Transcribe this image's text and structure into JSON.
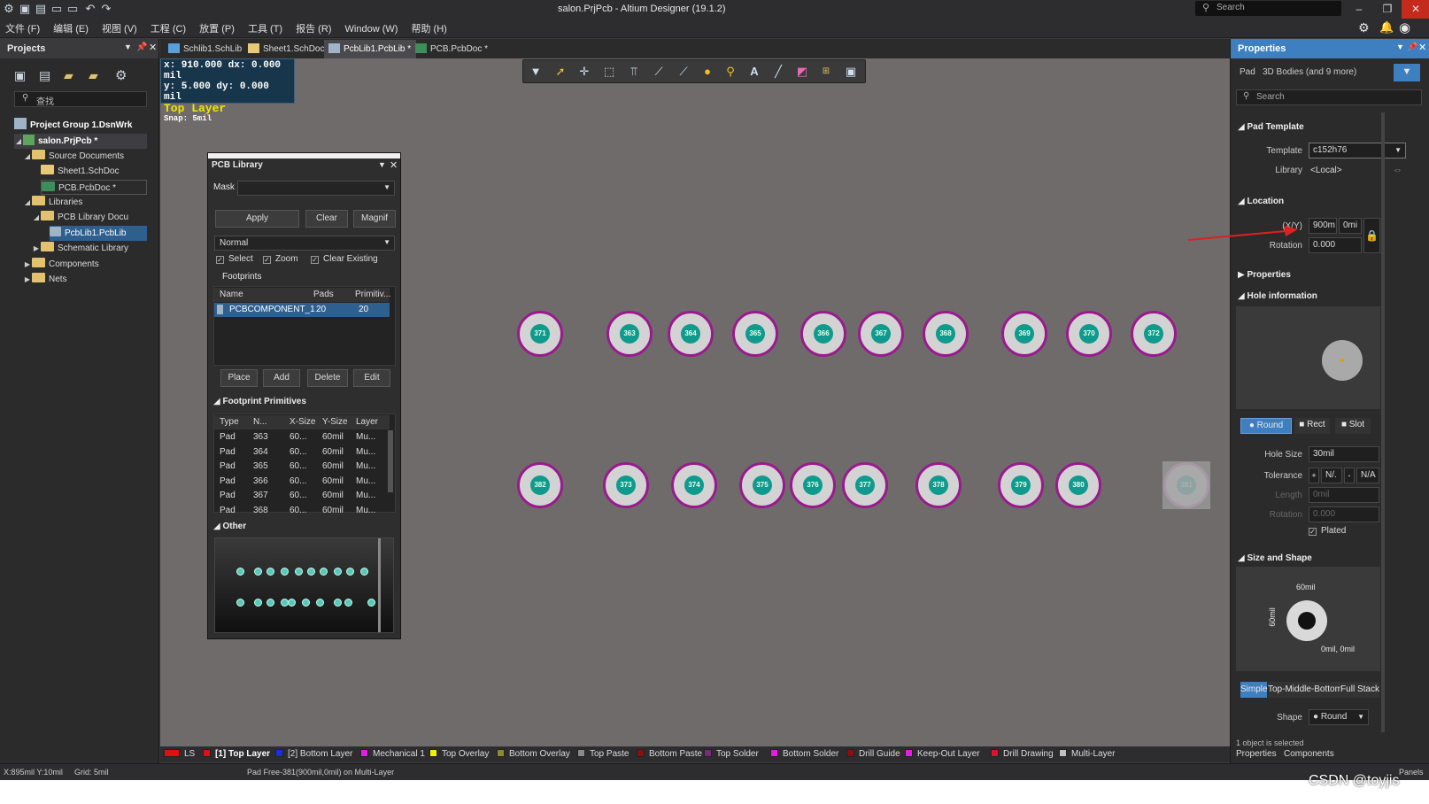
{
  "window": {
    "title": "salon.PrjPcb - Altium Designer (19.1.2)",
    "search_placeholder": "Search"
  },
  "menu": [
    "文件 (F)",
    "编辑 (E)",
    "视图 (V)",
    "工程 (C)",
    "放置 (P)",
    "工具 (T)",
    "报告 (R)",
    "Window (W)",
    "帮助 (H)"
  ],
  "projects": {
    "title": "Projects",
    "search_placeholder": "查找",
    "tree": [
      "Project Group 1.DsnWrk",
      "salon.PrjPcb *",
      "Source Documents",
      "Sheet1.SchDoc",
      "PCB.PcbDoc *",
      "Libraries",
      "PCB Library Docu",
      "PcbLib1.PcbLib",
      "Schematic Library",
      "Components",
      "Nets"
    ]
  },
  "tabs": [
    "Schlib1.SchLib",
    "Sheet1.SchDoc",
    "PcbLib1.PcbLib *",
    "PCB.PcbDoc *"
  ],
  "coords": {
    "x": "x:  910.000",
    "dx": "dx:   0.000 mil",
    "y": "y:    5.000",
    "dy": "dy:   0.000 mil",
    "layer": "Top Layer",
    "snap": "Snap: 5mil"
  },
  "pads_top": [
    "371",
    "363",
    "364",
    "365",
    "366",
    "367",
    "368",
    "369",
    "370",
    "372"
  ],
  "pads_bottom": [
    "382",
    "373",
    "374",
    "375",
    "376",
    "377",
    "378",
    "379",
    "380",
    "381"
  ],
  "pcblib": {
    "title": "PCB Library",
    "mask_label": "Mask",
    "apply": "Apply",
    "clear": "Clear",
    "magnify": "Magnif",
    "mode": "Normal",
    "select": "Select",
    "zoom": "Zoom",
    "clear_existing": "Clear Existing",
    "footprints_label": "Footprints",
    "fp_cols": [
      "Name",
      "Pads",
      "Primitiv..."
    ],
    "fp_row": [
      "PCBCOMPONENT_1",
      "20",
      "20"
    ],
    "place": "Place",
    "add": "Add",
    "delete": "Delete",
    "edit": "Edit",
    "primitives_label": "Footprint Primitives",
    "prim_cols": [
      "Type",
      "N...",
      "X-Size",
      "Y-Size",
      "Layer"
    ],
    "prim_rows": [
      [
        "Pad",
        "363",
        "60...",
        "60mil",
        "Mu..."
      ],
      [
        "Pad",
        "364",
        "60...",
        "60mil",
        "Mu..."
      ],
      [
        "Pad",
        "365",
        "60...",
        "60mil",
        "Mu..."
      ],
      [
        "Pad",
        "366",
        "60...",
        "60mil",
        "Mu..."
      ],
      [
        "Pad",
        "367",
        "60...",
        "60mil",
        "Mu..."
      ],
      [
        "Pad",
        "368",
        "60...",
        "60mil",
        "Mu..."
      ]
    ],
    "other_label": "Other"
  },
  "properties": {
    "title": "Properties",
    "filter_pad": "Pad",
    "filter_bodies": "3D Bodies (and 9 more)",
    "search_placeholder": "Search",
    "pad_template_label": "Pad Template",
    "template_label": "Template",
    "template_value": "c152h76",
    "library_label": "Library",
    "library_value": "<Local>",
    "location_label": "Location",
    "xy_label": "(X/Y)",
    "x_value": "900m",
    "y_value": "0mi",
    "rotation_label": "Rotation",
    "rotation_value": "0.000",
    "properties_label": "Properties",
    "hole_label": "Hole information",
    "round": "Round",
    "rect": "Rect",
    "slot": "Slot",
    "hole_size_label": "Hole Size",
    "hole_size_value": "30mil",
    "tolerance_label": "Tolerance",
    "tol_plus": "N/.",
    "tol_minus": "N/A",
    "length_label": "Length",
    "length_value": "0mil",
    "hole_rotation_label": "Rotation",
    "hole_rotation_value": "0.000",
    "plated": "Plated",
    "size_shape_label": "Size and Shape",
    "dim_x": "60mil",
    "dim_y": "60mil",
    "offset": "0mil, 0mil",
    "mode_simple": "Simple",
    "mode_tmb": "Top-Middle-Bottom",
    "mode_full": "Full Stack",
    "shape_label": "Shape",
    "shape_value": "Round",
    "selected": "1 object is selected",
    "footer_properties": "Properties",
    "footer_components": "Components"
  },
  "layers": [
    {
      "name": "LS",
      "color": "#e01010"
    },
    {
      "name": "[1] Top Layer",
      "color": "#e01010"
    },
    {
      "name": "[2] Bottom Layer",
      "color": "#1c2ee0"
    },
    {
      "name": "Mechanical 1",
      "color": "#e020e0"
    },
    {
      "name": "Top Overlay",
      "color": "#f0f000"
    },
    {
      "name": "Bottom Overlay",
      "color": "#8c8a2a"
    },
    {
      "name": "Top Paste",
      "color": "#8a8a8a"
    },
    {
      "name": "Bottom Paste",
      "color": "#8a1010"
    },
    {
      "name": "Top Solder",
      "color": "#7a2a7a"
    },
    {
      "name": "Bottom Solder",
      "color": "#e020e0"
    },
    {
      "name": "Drill Guide",
      "color": "#8a1010"
    },
    {
      "name": "Keep-Out Layer",
      "color": "#e020e0"
    },
    {
      "name": "Drill Drawing",
      "color": "#e01030"
    },
    {
      "name": "Multi-Layer",
      "color": "#c0c0c0"
    }
  ],
  "status": {
    "coords": "X:895mil Y:10mil",
    "grid": "Grid: 5mil",
    "message": "Pad Free-381(900mil,0mil) on Multi-Layer",
    "panels": "Panels"
  },
  "watermark": "CSDN @toyjis"
}
